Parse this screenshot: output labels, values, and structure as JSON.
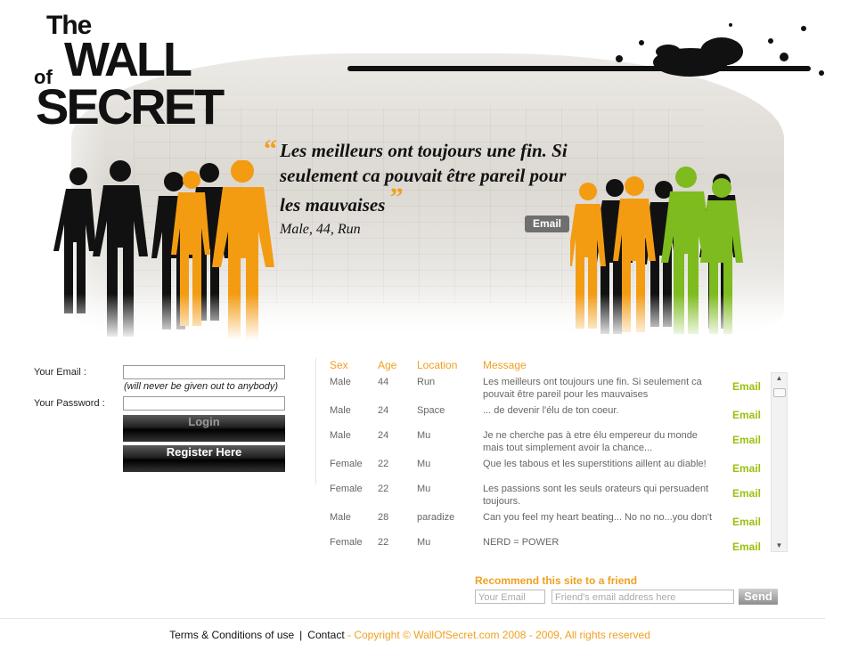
{
  "header": {
    "logo": {
      "line1": "The",
      "line2": "of",
      "line3": "WALL",
      "line4": "SECRET"
    },
    "quote": {
      "open_mark": "“",
      "close_mark": "”",
      "text": "Les meilleurs ont toujours une fin. Si seulement ca pouvait être pareil pour les mauvaises",
      "meta": "Male, 44, Run",
      "email_label": "Email"
    }
  },
  "login": {
    "email_label": "Your Email :",
    "email_value": "",
    "note": "(will never be given out to anybody)",
    "password_label": "Your Password :",
    "password_value": "",
    "login_button": "Login",
    "register_button": "Register Here"
  },
  "messages": {
    "headers": {
      "sex": "Sex",
      "age": "Age",
      "location": "Location",
      "message": "Message"
    },
    "rows": [
      {
        "sex": "Male",
        "age": "44",
        "location": "Run",
        "message": "Les meilleurs ont toujours une fin. Si seulement ca pouvait être pareil pour les mauvaises",
        "email": "Email"
      },
      {
        "sex": "Male",
        "age": "24",
        "location": "Space",
        "message": "... de devenir l'élu de ton coeur.",
        "email": "Email"
      },
      {
        "sex": "Male",
        "age": "24",
        "location": "Mu",
        "message": "Je ne cherche pas à etre élu empereur du monde mais tout simplement avoir la chance...",
        "email": "Email"
      },
      {
        "sex": "Female",
        "age": "22",
        "location": "Mu",
        "message": "Que les tabous et les superstitions aillent au diable!",
        "email": "Email"
      },
      {
        "sex": "Female",
        "age": "22",
        "location": "Mu",
        "message": "Les passions sont les seuls orateurs qui persuadent toujours.",
        "email": "Email"
      },
      {
        "sex": "Male",
        "age": "28",
        "location": "paradize",
        "message": "Can you feel my heart beating... No no no...you don't",
        "email": "Email"
      },
      {
        "sex": "Female",
        "age": "22",
        "location": "Mu",
        "message": "NERD = POWER",
        "email": "Email"
      }
    ],
    "scroll": {
      "up_icon": "▲",
      "down_icon": "▼"
    }
  },
  "recommend": {
    "title": "Recommend this site to a friend",
    "your_email_placeholder": "Your Email",
    "friend_email_placeholder": "Friend's email address here",
    "send_button": "Send"
  },
  "footer": {
    "terms": "Terms & Conditions of use",
    "separator": "|",
    "contact": "Contact",
    "copyright": "- Copyright © WallOfSecret.com 2008 - 2009, All rights reserved"
  },
  "colors": {
    "accent_orange": "#f0a020",
    "accent_green": "#9ac00e",
    "silhouette_dark": "#111111",
    "silhouette_orange": "#f39c12",
    "silhouette_green": "#7dbb1e"
  }
}
